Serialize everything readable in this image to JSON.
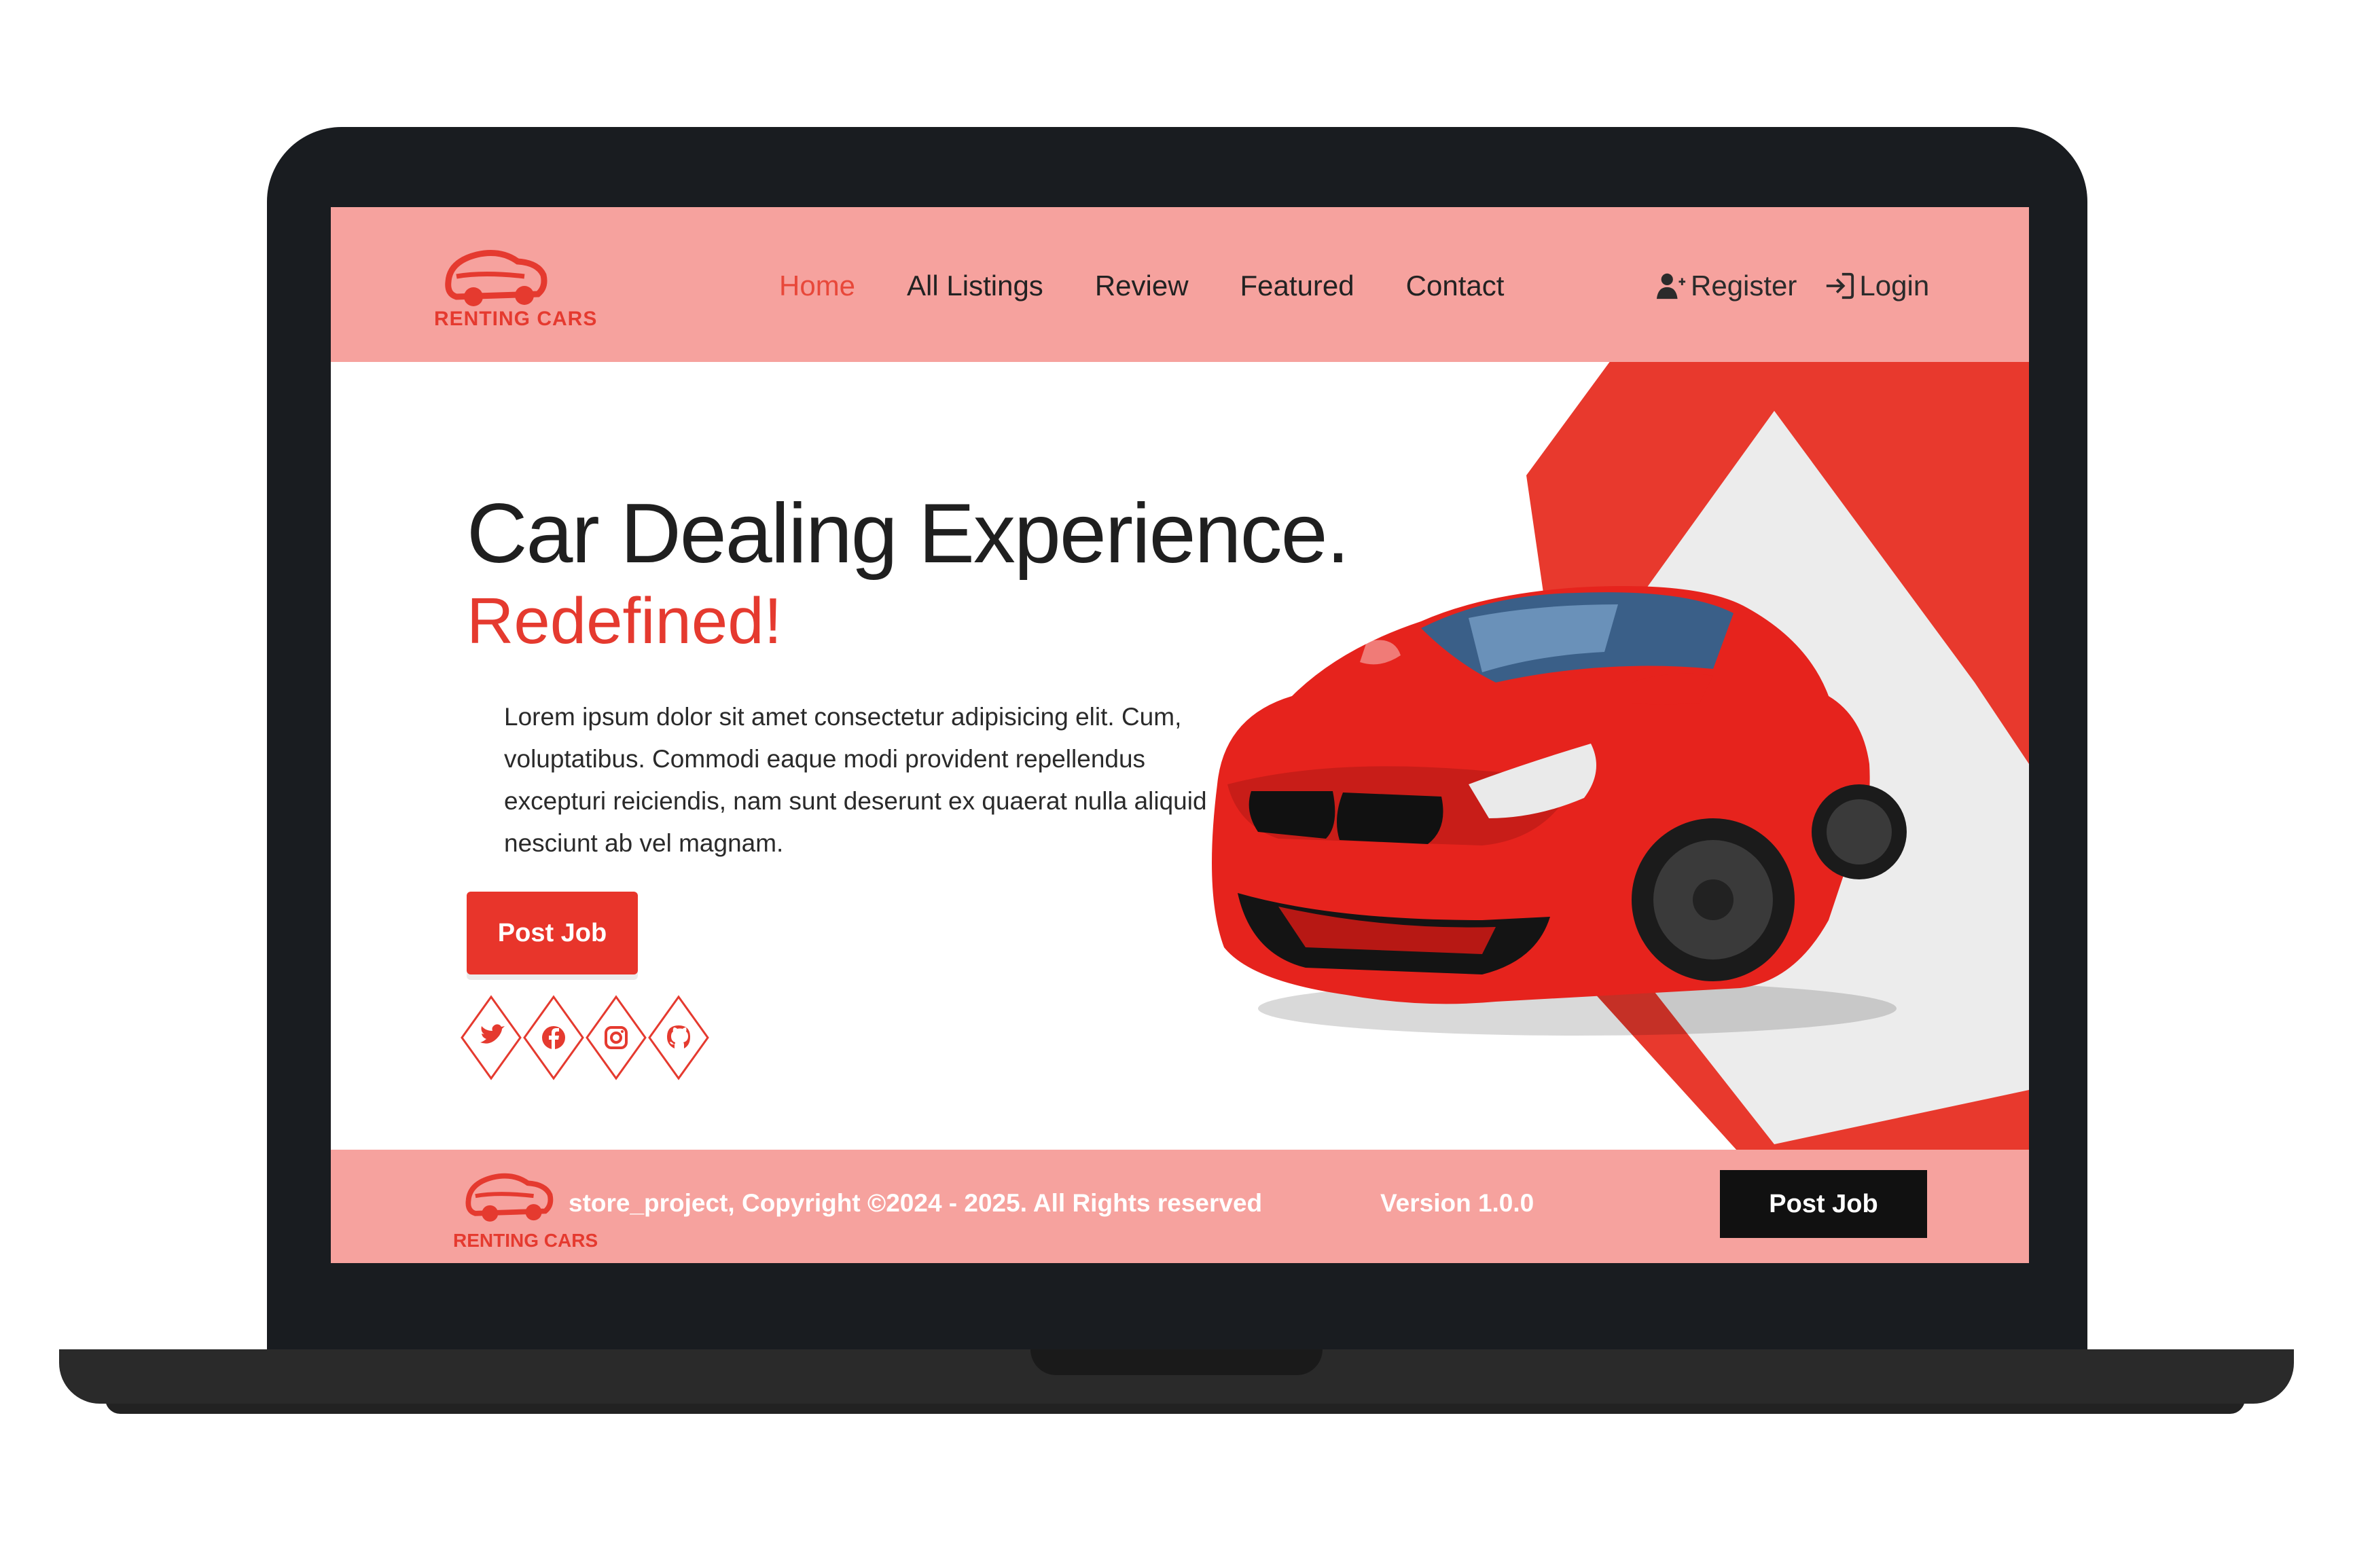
{
  "brand": {
    "logo_text": "RENTING CARS",
    "accent": "#e53a2f",
    "header_bg": "#f6a29e"
  },
  "nav": {
    "items": [
      {
        "label": "Home",
        "active": true
      },
      {
        "label": "All Listings"
      },
      {
        "label": "Review"
      },
      {
        "label": "Featured"
      },
      {
        "label": "Contact"
      }
    ]
  },
  "auth": {
    "register": "Register",
    "login": "Login",
    "register_icon": "user-plus-icon",
    "login_icon": "sign-in-icon"
  },
  "hero": {
    "title": "Car Dealing Experience.",
    "subtitle": "Redefined!",
    "description": "Lorem ipsum dolor sit amet consectetur adipisicing elit. Cum, voluptatibus. Commodi eaque modi provident repellendus excepturi reiciendis, nam sunt deserunt ex quaerat nulla aliquid nesciunt ab vel magnam.",
    "cta": "Post Job",
    "socials": [
      "twitter-icon",
      "facebook-icon",
      "instagram-icon",
      "github-icon"
    ]
  },
  "footer": {
    "logo_text": "RENTING CARS",
    "copyright": "store_project, Copyright ©2024 - 2025. All Rights reserved",
    "version": "Version 1.0.0",
    "cta": "Post Job"
  }
}
